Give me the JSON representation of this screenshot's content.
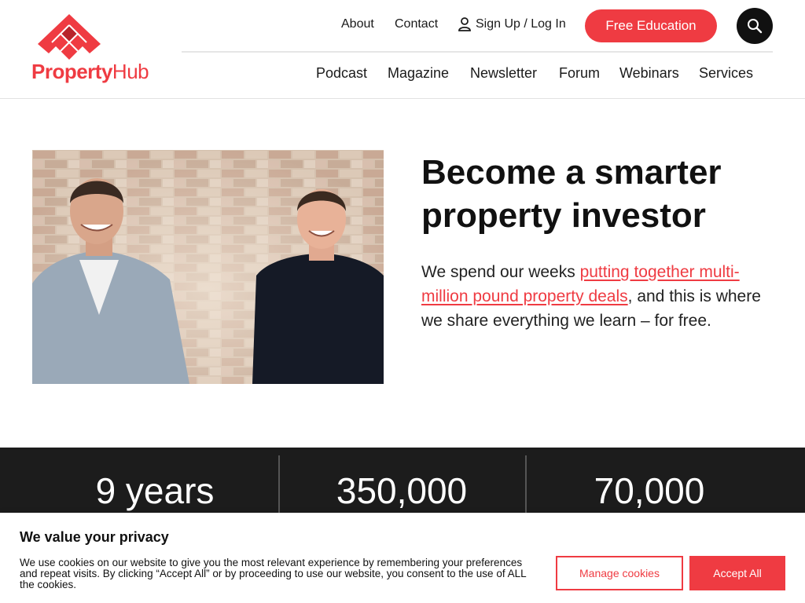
{
  "brand": {
    "name_part1": "Property",
    "name_part2": "Hub",
    "accent_color": "#ef3b42"
  },
  "topnav": {
    "about": "About",
    "contact": "Contact",
    "signup": "Sign Up / Log In",
    "signup_icon": "user-icon",
    "cta": "Free Education",
    "search_icon": "search-icon"
  },
  "mainnav": {
    "items": [
      "Podcast",
      "Magazine",
      "Newsletter",
      "Forum",
      "Webinars",
      "Services"
    ]
  },
  "hero": {
    "title_line1": "Become a smarter",
    "title_line2": "property investor",
    "text_before": "We spend our weeks ",
    "link_text": "putting together multi-million pound property deals",
    "text_after": ", and this is where we share everything we learn – for free."
  },
  "stats": {
    "items": [
      "9 years",
      "350,000",
      "70,000"
    ],
    "background": "#1c1c1c"
  },
  "cookie": {
    "title": "We value your privacy",
    "text": "We use cookies on our website to give you the most relevant experience by remembering your preferences and repeat visits. By clicking “Accept All” or by proceeding to use our website, you consent to the use of ALL the cookies.",
    "manage": "Manage cookies",
    "accept": "Accept All"
  }
}
